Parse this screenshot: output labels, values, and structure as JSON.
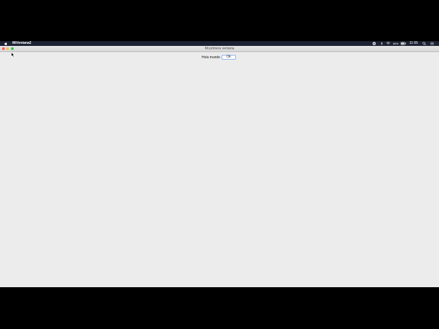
{
  "menubar": {
    "app_name": "MiVentana2",
    "battery_percent": "86%",
    "clock": "11:55",
    "icons": [
      "apple-icon",
      "siri-icon",
      "bluetooth-icon",
      "wifi-icon",
      "battery-icon",
      "spotlight-icon",
      "notification-center-icon"
    ]
  },
  "window": {
    "title": "Mi primera ventana"
  },
  "content": {
    "label": "Hola mundo",
    "button_label": "Ok"
  }
}
